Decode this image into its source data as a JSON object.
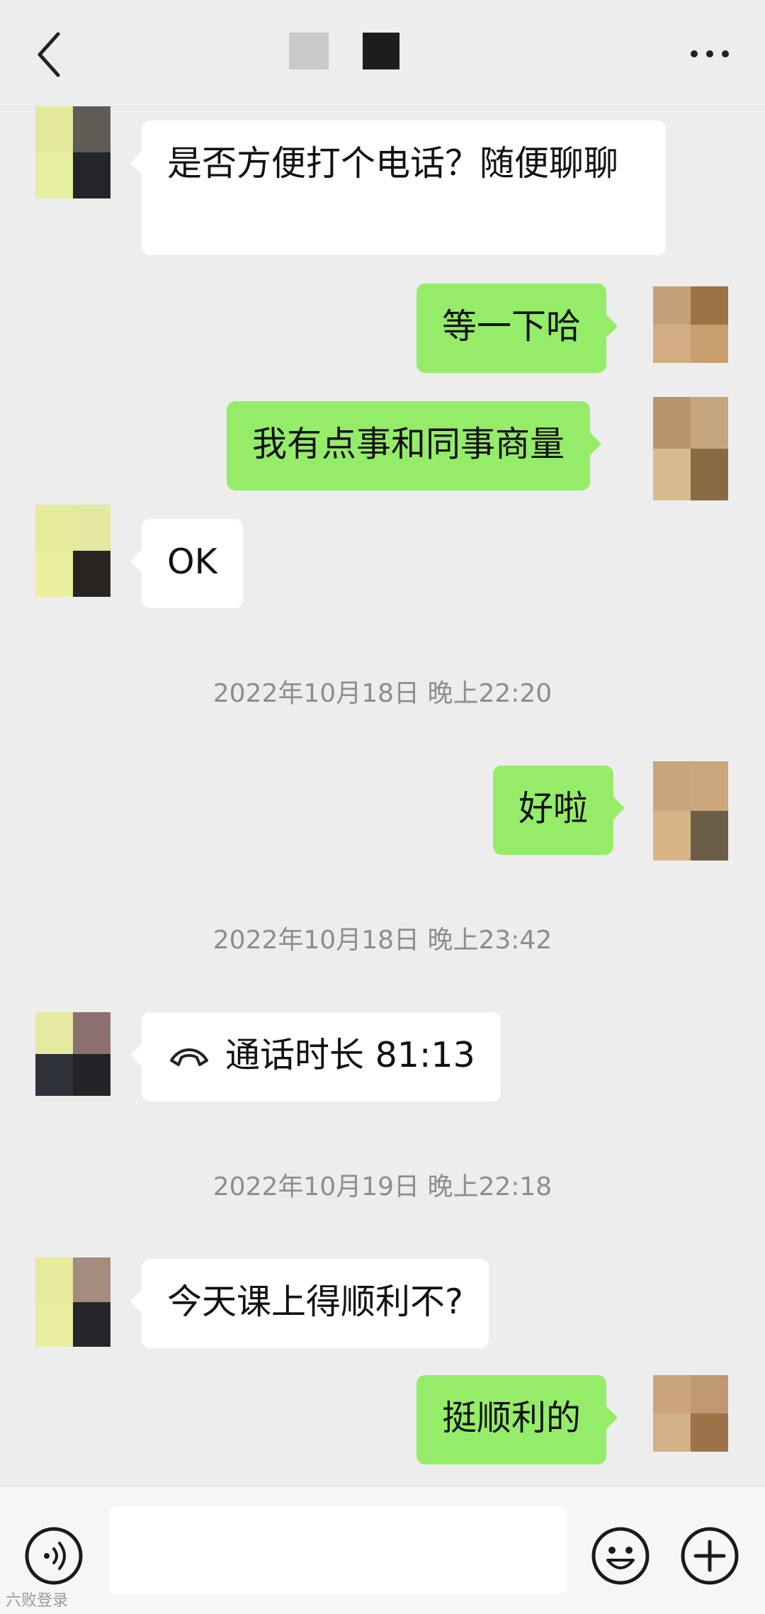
{
  "header": {
    "back_icon": "chevron-left-icon",
    "more_icon": "more-dots-icon",
    "title_obscured": true
  },
  "messages": [
    {
      "side": "left",
      "text": "是否方便打个电话？随便聊聊"
    },
    {
      "side": "right",
      "text": "等一下哈"
    },
    {
      "side": "right",
      "text": "我有点事和同事商量"
    },
    {
      "side": "left",
      "text": "OK"
    },
    {
      "type": "time",
      "text": "2022年10月18日 晚上22:20"
    },
    {
      "side": "right",
      "text": "好啦"
    },
    {
      "type": "time",
      "text": "2022年10月18日 晚上23:42"
    },
    {
      "side": "left",
      "type": "call",
      "icon": "phone-hangup-icon",
      "text": "通话时长 81:13"
    },
    {
      "type": "time",
      "text": "2022年10月19日 晚上22:18"
    },
    {
      "side": "left",
      "text": "今天课上得顺利不?"
    },
    {
      "side": "right",
      "text": "挺顺利的"
    }
  ],
  "footer": {
    "voice_icon": "voice-icon",
    "emoji_icon": "emoji-icon",
    "plus_icon": "plus-icon",
    "input_value": ""
  },
  "watermark": "六败登录",
  "colors": {
    "background": "#ededed",
    "bubble_left": "#ffffff",
    "bubble_right": "#95ec69",
    "timestamp": "#8d8d8d"
  }
}
